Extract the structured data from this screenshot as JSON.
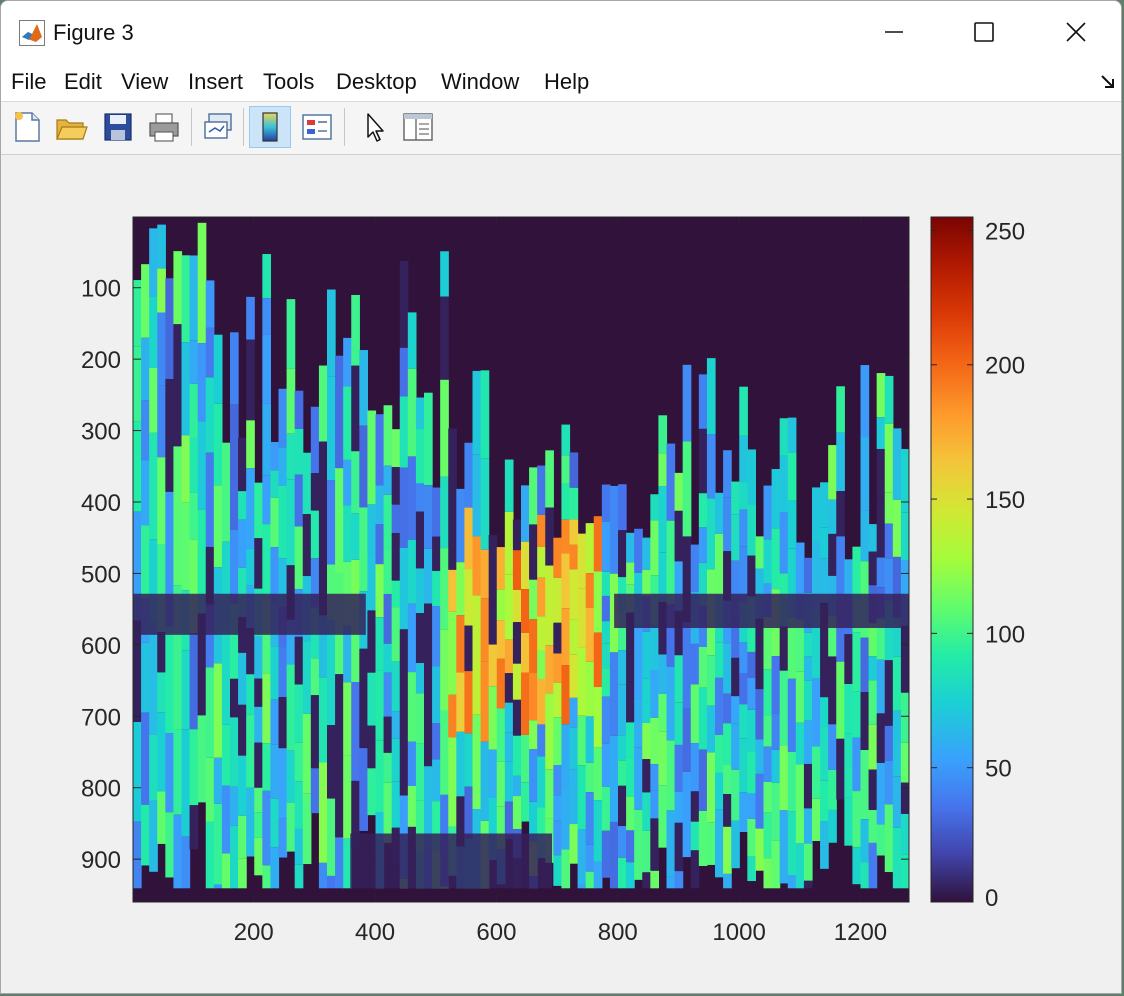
{
  "window": {
    "title": "Figure 3"
  },
  "menu": {
    "items": [
      "File",
      "Edit",
      "View",
      "Insert",
      "Tools",
      "Desktop",
      "Window",
      "Help"
    ]
  },
  "toolbar": {
    "icons": [
      "new-figure-icon",
      "open-file-icon",
      "save-icon",
      "print-icon",
      "link-plot-icon",
      "colorbar-icon",
      "legend-icon",
      "pointer-icon",
      "property-inspector-icon"
    ],
    "active": "colorbar-icon"
  },
  "colors": {
    "cmap_low": "#30123b",
    "cmap_mid": "#1ae4b6",
    "cmap_high": "#7a0403"
  },
  "chart_data": {
    "type": "heatmap",
    "colormap": "turbo",
    "x_ticks": [
      200,
      400,
      600,
      800,
      1000,
      1200
    ],
    "y_ticks": [
      100,
      200,
      300,
      400,
      500,
      600,
      700,
      800,
      900
    ],
    "xlim": [
      1,
      1280
    ],
    "ylim": [
      1,
      960
    ],
    "colorbar": {
      "range": [
        0,
        255
      ],
      "ticks": [
        0,
        50,
        100,
        150,
        200,
        250
      ]
    }
  }
}
